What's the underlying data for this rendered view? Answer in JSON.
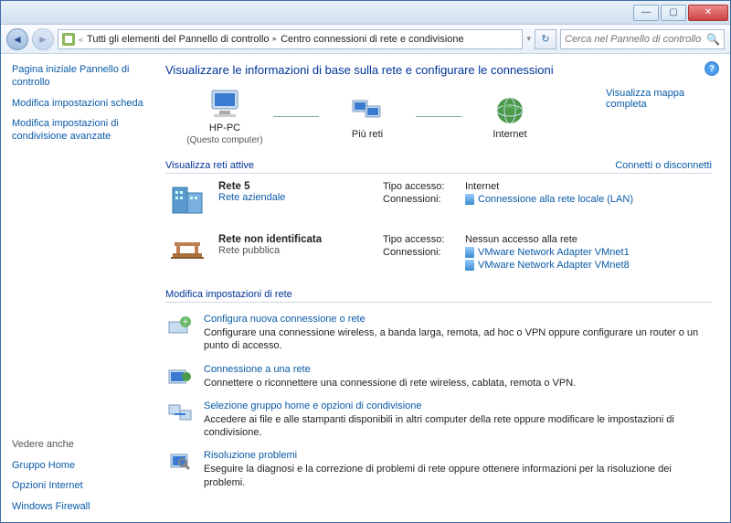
{
  "titlebar": {
    "min": "—",
    "max": "▢",
    "close": "✕"
  },
  "breadcrumb": {
    "root_icon": "control-panel",
    "crumb1": "Tutti gli elementi del Pannello di controllo",
    "crumb2": "Centro connessioni di rete e condivisione"
  },
  "search": {
    "placeholder": "Cerca nel Pannello di controllo"
  },
  "sidebar": {
    "links": [
      "Pagina iniziale Pannello di controllo",
      "Modifica impostazioni scheda",
      "Modifica impostazioni di condivisione avanzate"
    ],
    "see_also_hdr": "Vedere anche",
    "see_also": [
      "Gruppo Home",
      "Opzioni Internet",
      "Windows Firewall"
    ]
  },
  "main": {
    "title": "Visualizzare le informazioni di base sulla rete e configurare le connessioni",
    "map": {
      "node1": "HP-PC",
      "node1_sub": "(Questo computer)",
      "node2": "Più reti",
      "node3": "Internet",
      "full_map": "Visualizza mappa completa"
    },
    "active_hdr": "Visualizza reti attive",
    "connect_link": "Connetti o disconnetti",
    "net1": {
      "name": "Rete 5",
      "type": "Rete aziendale",
      "access_lbl": "Tipo accesso:",
      "access_val": "Internet",
      "conn_lbl": "Connessioni:",
      "conn_link": "Connessione alla rete locale (LAN)"
    },
    "net2": {
      "name": "Rete non identificata",
      "type": "Rete pubblica",
      "access_lbl": "Tipo accesso:",
      "access_val": "Nessun accesso alla rete",
      "conn_lbl": "Connessioni:",
      "conn_link1": "VMware Network Adapter VMnet1",
      "conn_link2": "VMware Network Adapter VMnet8"
    },
    "settings_hdr": "Modifica impostazioni di rete",
    "tasks": [
      {
        "title": "Configura nuova connessione o rete",
        "desc": "Configurare una connessione wireless, a banda larga, remota, ad hoc o VPN oppure configurare un router o un punto di accesso."
      },
      {
        "title": "Connessione a una rete",
        "desc": "Connettere o riconnettere una connessione di rete wireless, cablata, remota o VPN."
      },
      {
        "title": "Selezione gruppo home e opzioni di condivisione",
        "desc": "Accedere ai file e alle stampanti disponibili in altri computer della rete oppure modificare le impostazioni di condivisione."
      },
      {
        "title": "Risoluzione problemi",
        "desc": "Eseguire la diagnosi e la correzione di problemi di rete oppure ottenere informazioni per la risoluzione dei problemi."
      }
    ]
  }
}
